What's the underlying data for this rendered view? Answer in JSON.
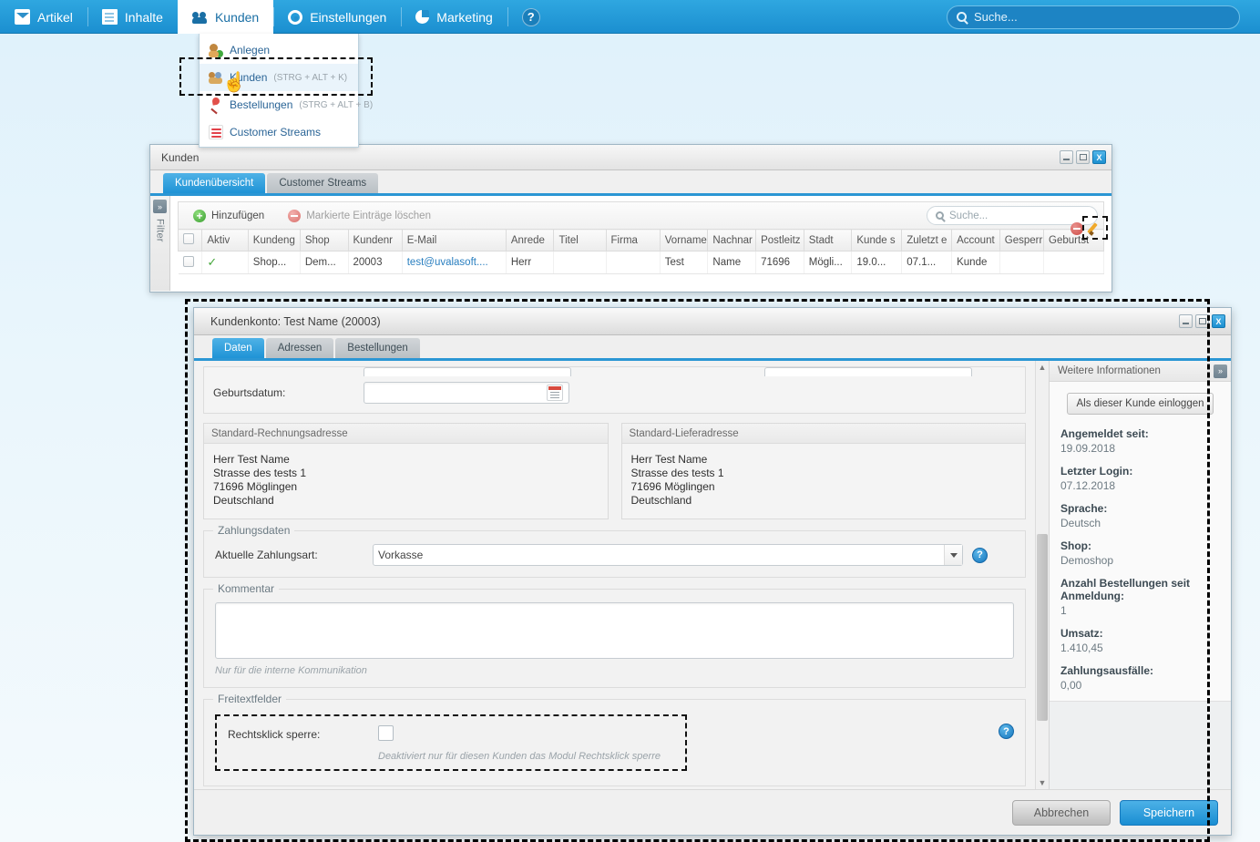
{
  "topnav": {
    "items": [
      {
        "label": "Artikel",
        "icon": "inbox-icon",
        "active": false
      },
      {
        "label": "Inhalte",
        "icon": "page-icon",
        "active": false
      },
      {
        "label": "Kunden",
        "icon": "users-icon",
        "active": true
      },
      {
        "label": "Einstellungen",
        "icon": "gear-icon",
        "active": false
      },
      {
        "label": "Marketing",
        "icon": "pie-chart-icon",
        "active": false
      }
    ],
    "help_label": "?",
    "search_placeholder": "Suche..."
  },
  "kunden_menu": {
    "items": [
      {
        "label": "Anlegen",
        "shortcut": "",
        "icon": "user-add-icon",
        "highlighted": false
      },
      {
        "label": "Kunden",
        "shortcut": "(STRG + ALT + K)",
        "icon": "user-group-icon",
        "highlighted": true
      },
      {
        "label": "Bestellungen",
        "shortcut": "(STRG + ALT + B)",
        "icon": "pin-icon",
        "highlighted": false
      },
      {
        "label": "Customer Streams",
        "shortcut": "",
        "icon": "stream-icon",
        "highlighted": false
      }
    ]
  },
  "kunden_window": {
    "title": "Kunden",
    "controls": {
      "minimize": "_",
      "maximize": "□",
      "close": "X"
    },
    "tabs": [
      {
        "label": "Kundenübersicht",
        "active": true
      },
      {
        "label": "Customer Streams",
        "active": false
      }
    ],
    "filter_rail": {
      "expand": "»",
      "label": "Filter"
    },
    "toolbar": {
      "add_label": "Hinzufügen",
      "delete_label": "Markierte Einträge löschen",
      "search_placeholder": "Suche..."
    },
    "grid": {
      "columns": [
        "",
        "Aktiv",
        "Kundeng",
        "Shop",
        "Kundenr",
        "E-Mail",
        "Anrede",
        "Titel",
        "Firma",
        "Vorname",
        "Nachnar",
        "Postleitz",
        "Stadt",
        "Kunde s",
        "Zuletzt e",
        "Account",
        "Gesperr",
        "Geburtst"
      ],
      "rows": [
        {
          "checkbox": "",
          "aktiv": "✓",
          "kundengruppe": "Shop...",
          "shop": "Dem...",
          "kundennummer": "20003",
          "email": "test@uvalasoft....",
          "anrede": "Herr",
          "titel": "",
          "firma": "",
          "vorname": "Test",
          "nachname": "Name",
          "plz": "71696",
          "stadt": "Mögli...",
          "kunde_seit": "19.0...",
          "zuletzt": "07.1...",
          "account": "Kunde",
          "gesperrt": "",
          "geburtstag": ""
        }
      ]
    }
  },
  "konto_window": {
    "title": "Kundenkonto: Test Name (20003)",
    "tabs": [
      {
        "label": "Daten",
        "active": true
      },
      {
        "label": "Adressen",
        "active": false
      },
      {
        "label": "Bestellungen",
        "active": false
      }
    ],
    "birthdate": {
      "label": "Geburtsdatum:",
      "value": "",
      "calendar_icon": "calendar-icon"
    },
    "billing": {
      "title": "Standard-Rechnungsadresse",
      "lines": [
        "Herr Test Name",
        "Strasse des tests 1",
        "71696 Möglingen",
        "Deutschland"
      ]
    },
    "shipping": {
      "title": "Standard-Lieferadresse",
      "lines": [
        "Herr Test Name",
        "Strasse des tests 1",
        "71696 Möglingen",
        "Deutschland"
      ]
    },
    "payment": {
      "legend": "Zahlungsdaten",
      "label": "Aktuelle Zahlungsart:",
      "value": "Vorkasse",
      "options": [
        "Vorkasse"
      ],
      "help": "?"
    },
    "comment": {
      "legend": "Kommentar",
      "value": "",
      "hint": "Nur für die interne Kommunikation"
    },
    "freetext": {
      "legend": "Freitextfelder",
      "label": "Rechtsklick sperre:",
      "checked": false,
      "hint": "Deaktiviert nur für diesen Kunden das Modul Rechtsklick sperre",
      "help": "?"
    },
    "footer": {
      "cancel_label": "Abbrechen",
      "save_label": "Speichern"
    }
  },
  "side_panel": {
    "title": "Weitere Informationen",
    "collapse_icon": "»",
    "login_button": "Als dieser Kunde einloggen",
    "info": [
      {
        "key": "Angemeldet seit:",
        "value": "19.09.2018"
      },
      {
        "key": "Letzter Login:",
        "value": "07.12.2018"
      },
      {
        "key": "Sprache:",
        "value": "Deutsch"
      },
      {
        "key": "Shop:",
        "value": "Demoshop"
      },
      {
        "key": "Anzahl Bestellungen seit Anmeldung:",
        "value": "1"
      },
      {
        "key": "Umsatz:",
        "value": "1.410,45"
      },
      {
        "key": "Zahlungsausfälle:",
        "value": "0,00"
      }
    ]
  },
  "colors": {
    "brand_blue": "#1b8fd0",
    "accent_blue": "#2b96d4",
    "link_blue": "#2a7fc0",
    "tick_green": "#46a83c",
    "delete_red": "#cf4b46",
    "edit_orange": "#f0a92c"
  }
}
